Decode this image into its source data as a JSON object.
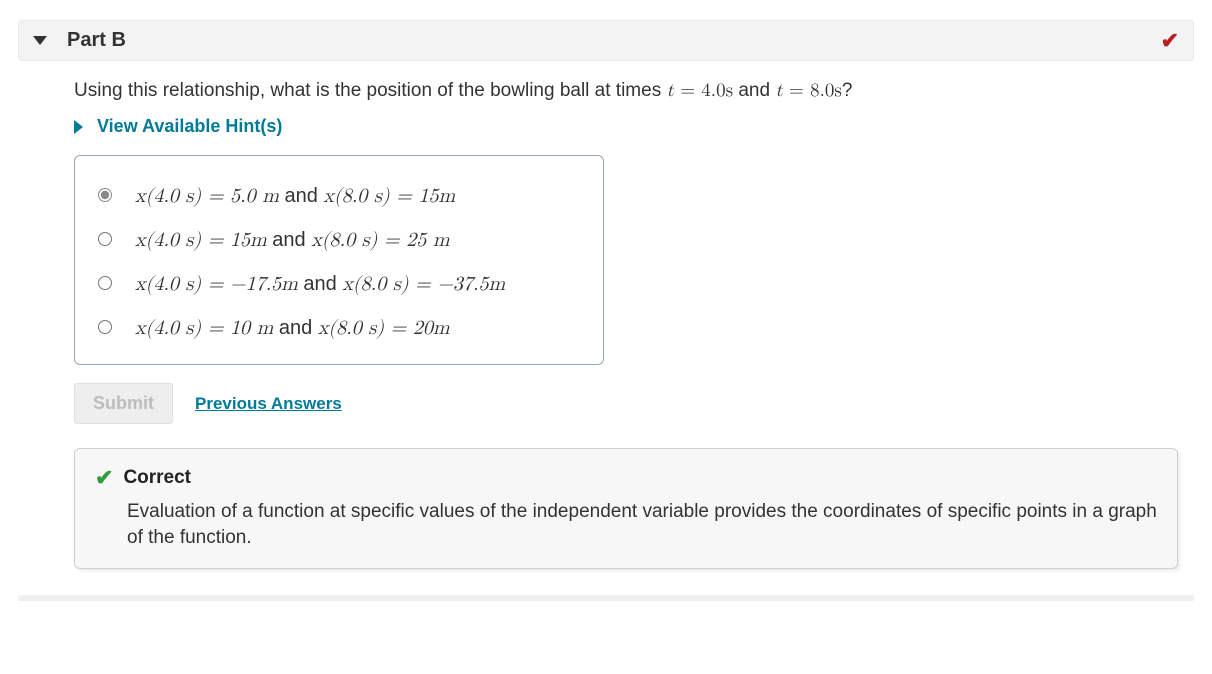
{
  "part": {
    "title": "Part B",
    "completed": true
  },
  "question": {
    "prefix": "Using this relationship, what is the position of the bowling ball at times ",
    "t1_var": "t",
    "t1_eq": " = 4.0s",
    "mid": " and ",
    "t2_var": "t",
    "t2_eq": " = 8.0s",
    "suffix": "?"
  },
  "hints_label": "View Available Hint(s)",
  "options": [
    {
      "selected": true,
      "x1": "x(4.0 s) = 5.0 m",
      "conj": "and",
      "x2": "x(8.0 s) = 15m"
    },
    {
      "selected": false,
      "x1": "x(4.0 s) = 15m",
      "conj": "and",
      "x2": "x(8.0 s) = 25 m"
    },
    {
      "selected": false,
      "x1": "x(4.0 s) = −17.5m",
      "conj": "and",
      "x2": "x(8.0 s) = −37.5m"
    },
    {
      "selected": false,
      "x1": "x(4.0 s) = 10 m",
      "conj": "and",
      "x2": "x(8.0 s) = 20m"
    }
  ],
  "actions": {
    "submit_label": "Submit",
    "previous_answers_label": "Previous Answers"
  },
  "feedback": {
    "status": "Correct",
    "text": "Evaluation of a function at specific values of the independent variable provides the coordinates of specific points in a graph of the function."
  }
}
